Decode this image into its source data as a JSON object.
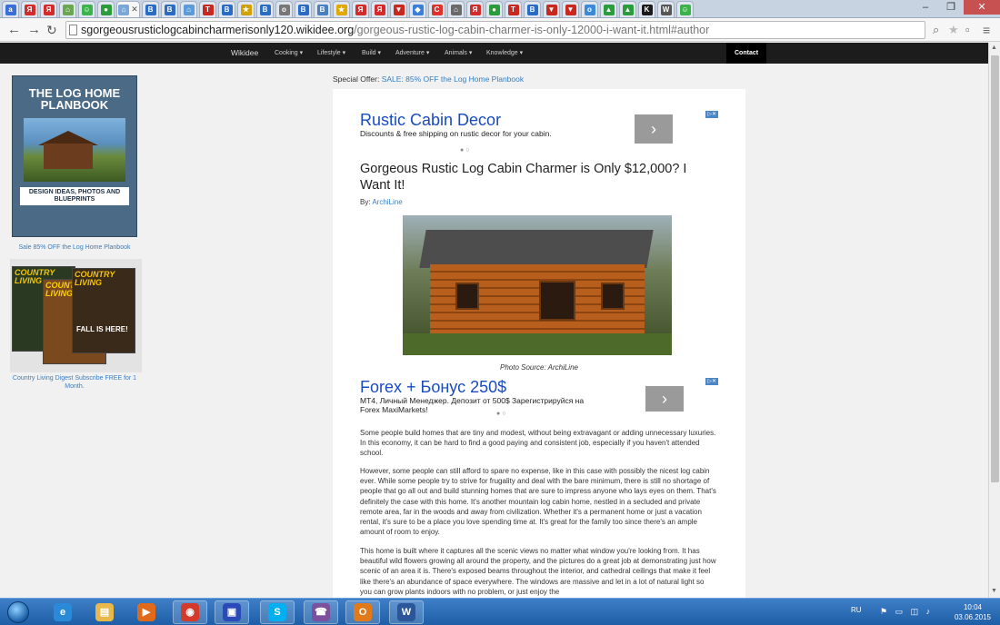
{
  "browser": {
    "tabs": [
      {
        "glyph": "a",
        "color": "#3a6fd8"
      },
      {
        "glyph": "Я",
        "color": "#d42a2a"
      },
      {
        "glyph": "Я",
        "color": "#d42a2a"
      },
      {
        "glyph": "⌂",
        "color": "#6aa84f"
      },
      {
        "glyph": "☺",
        "color": "#3bb34a"
      },
      {
        "glyph": "●",
        "color": "#2a9d3a"
      },
      {
        "glyph": "⌂",
        "color": "#7aa6d8"
      },
      {
        "glyph": "B",
        "color": "#2a6bc4"
      },
      {
        "glyph": "B",
        "color": "#2a6bc4"
      },
      {
        "glyph": "⌂",
        "color": "#5a9bd8"
      },
      {
        "glyph": "T",
        "color": "#c8281e"
      },
      {
        "glyph": "B",
        "color": "#2a6bc4"
      },
      {
        "glyph": "★",
        "color": "#d4a000"
      },
      {
        "glyph": "B",
        "color": "#2a6bc4"
      },
      {
        "glyph": "o",
        "color": "#777777"
      },
      {
        "glyph": "В",
        "color": "#2a6bc4"
      },
      {
        "glyph": "В",
        "color": "#4a7fc4"
      },
      {
        "glyph": "★",
        "color": "#e0a800"
      },
      {
        "glyph": "Я",
        "color": "#d42a2a"
      },
      {
        "glyph": "Я",
        "color": "#d42a2a"
      },
      {
        "glyph": "▼",
        "color": "#c8281e"
      },
      {
        "glyph": "◆",
        "color": "#3a7ed8"
      },
      {
        "glyph": "C",
        "color": "#e0302a"
      },
      {
        "glyph": "⌂",
        "color": "#6a6a6a"
      },
      {
        "glyph": "Я",
        "color": "#d42a2a"
      },
      {
        "glyph": "●",
        "color": "#2a9d3a"
      },
      {
        "glyph": "T",
        "color": "#c8281e"
      },
      {
        "glyph": "B",
        "color": "#2a6bc4"
      },
      {
        "glyph": "▼",
        "color": "#c8281e"
      },
      {
        "glyph": "▼",
        "color": "#c8281e"
      },
      {
        "glyph": "o",
        "color": "#3a8ad8"
      },
      {
        "glyph": "▲",
        "color": "#2a9d3a"
      },
      {
        "glyph": "▲",
        "color": "#2a9d3a"
      },
      {
        "glyph": "K",
        "color": "#1a1a1a"
      },
      {
        "glyph": "W",
        "color": "#555555"
      },
      {
        "glyph": "☺",
        "color": "#3bb34a"
      }
    ],
    "active_tab_index": 6,
    "url_host": "sgorgeousrusticlogcabincharmerisonly120.wikidee.org",
    "url_path": "/gorgeous-rustic-log-cabin-charmer-is-only-12000-i-want-it.html#author"
  },
  "site_nav": {
    "brand": "Wikidee",
    "items": [
      "Cooking",
      "Lifestyle",
      "Build",
      "Adventure",
      "Animals",
      "Knowledge"
    ],
    "contact": "Contact"
  },
  "special_offer": {
    "prefix": "Special Offer:",
    "link": "SALE: 85% OFF the Log Home Planbook"
  },
  "sidebar": {
    "book_title": "THE LOG HOME PLANBOOK",
    "book_tag": "DESIGN IDEAS, PHOTOS AND BLUEPRINTS",
    "book_caption": "Sale 85% OFF the Log Home Planbook",
    "mag_title": "COUNTRY LIVING",
    "mag_cover_text": "FALL IS HERE!",
    "mag_caption": "Country Living Digest Subscribe FREE for 1 Month."
  },
  "ad1": {
    "title": "Rustic Cabin Decor",
    "text": "Discounts & free shipping on rustic decor for your cabin."
  },
  "ad2": {
    "title": "Forex + Бонус 250$",
    "text": "МТ4, Личный Менеджер. Депозит от 500$ Зарегистрируйся на Forex",
    "text2": "MaxiMarkets!"
  },
  "article": {
    "title": "Gorgeous Rustic Log Cabin Charmer is Only $12,000? I Want It!",
    "by_label": "By:",
    "author": "ArchiLine",
    "caption": "Photo Source: ArchiLine",
    "paragraphs": [
      "Some people build homes that are tiny and modest, without being extravagant or adding unnecessary luxuries. In this economy, it can be hard to find a good paying and consistent job, especially if you haven't attended school.",
      "However, some people can still afford to spare no expense, like in this case with possibly the nicest log cabin ever. While some people try to strive for frugality and deal with the bare minimum, there is still no shortage of people that go all out and build stunning homes that are sure to impress anyone who lays eyes on them. That's definitely the case with this home. It's another mountain log cabin home, nestled in a secluded and private remote area, far in the woods and away from civilization. Whether it's a permanent home or just a vacation rental, it's sure to be a place you love spending time at. It's great for the family too since there's an ample amount of room to enjoy.",
      "This home is built where it captures all the scenic views no matter what window you're looking from. It has beautiful wild flowers growing all around the property, and the pictures do a great job at demonstrating just how scenic of an area it is. There's exposed beams throughout the interior, and cathedral ceilings that make it feel like there's an abundance of space everywhere. The windows are massive and let in a lot of natural light so you can grow plants indoors with no problem, or just enjoy the"
    ]
  },
  "taskbar": {
    "apps": [
      {
        "name": "internet-explorer",
        "glyph": "e",
        "color": "#2a8ad8"
      },
      {
        "name": "file-explorer",
        "glyph": "▤",
        "color": "#e8b84a"
      },
      {
        "name": "media-player",
        "glyph": "▶",
        "color": "#e06a1a"
      },
      {
        "name": "chrome",
        "glyph": "◉",
        "color": "#d43a2a"
      },
      {
        "name": "save-app",
        "glyph": "▣",
        "color": "#2a4ab8"
      },
      {
        "name": "skype",
        "glyph": "S",
        "color": "#00aff0"
      },
      {
        "name": "viber",
        "glyph": "☎",
        "color": "#7b519d"
      },
      {
        "name": "outlook",
        "glyph": "O",
        "color": "#e07a1a"
      },
      {
        "name": "word",
        "glyph": "W",
        "color": "#2b579a"
      }
    ],
    "lang": "RU",
    "time": "10:04",
    "date": "03.06.2015"
  }
}
